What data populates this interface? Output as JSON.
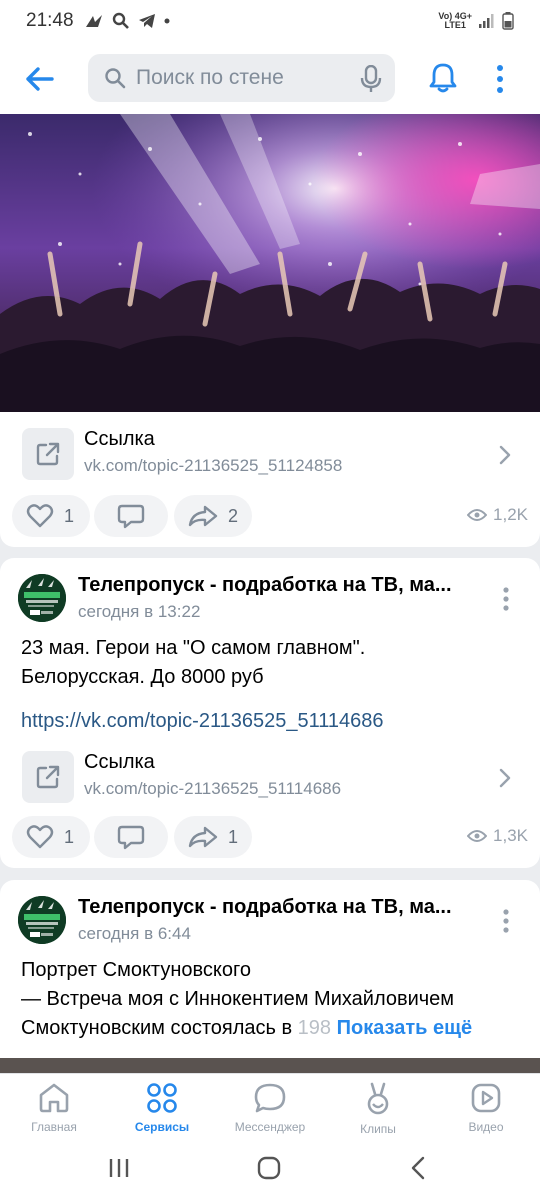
{
  "status_bar": {
    "time": "21:48",
    "network_top": "Vo) 4G+",
    "network_bottom": "LTE1"
  },
  "header": {
    "search_placeholder": "Поиск по стене"
  },
  "posts": [
    {
      "link_card": {
        "title": "Ссылка",
        "url": "vk.com/topic-21136525_51124858"
      },
      "likes": "1",
      "shares": "2",
      "views": "1,2K"
    },
    {
      "author": "Телепропуск - подработка на ТВ,  ма...",
      "time": "сегодня в 13:22",
      "text_line1": "23 мая. Герои на \"О самом главном\".",
      "text_line2": "Белорусская. До 8000 руб",
      "inline_link": "https://vk.com/topic-21136525_51114686",
      "link_card": {
        "title": "Ссылка",
        "url": "vk.com/topic-21136525_51114686"
      },
      "likes": "1",
      "shares": "1",
      "views": "1,3K"
    },
    {
      "author": "Телепропуск - подработка на ТВ,  ма...",
      "time": "сегодня в 6:44",
      "text_line1": "Портрет Смоктуновского",
      "text_line2": "— Встреча моя с Иннокентием Михайловичем",
      "text_line3": "Смоктуновским состоялась в",
      "text_line3_faded": "198",
      "show_more": "Показать ещё"
    }
  ],
  "bottom_nav": [
    {
      "label": "Главная",
      "icon": "home-icon",
      "active": false
    },
    {
      "label": "Сервисы",
      "icon": "services-icon",
      "active": true
    },
    {
      "label": "Мессенджер",
      "icon": "messenger-icon",
      "active": false
    },
    {
      "label": "Клипы",
      "icon": "clips-icon",
      "active": false
    },
    {
      "label": "Видео",
      "icon": "video-icon",
      "active": false
    }
  ],
  "colors": {
    "accent": "#2688eb",
    "link": "#2a5885",
    "secondary_text": "#818c99",
    "background": "#ebedf0"
  }
}
